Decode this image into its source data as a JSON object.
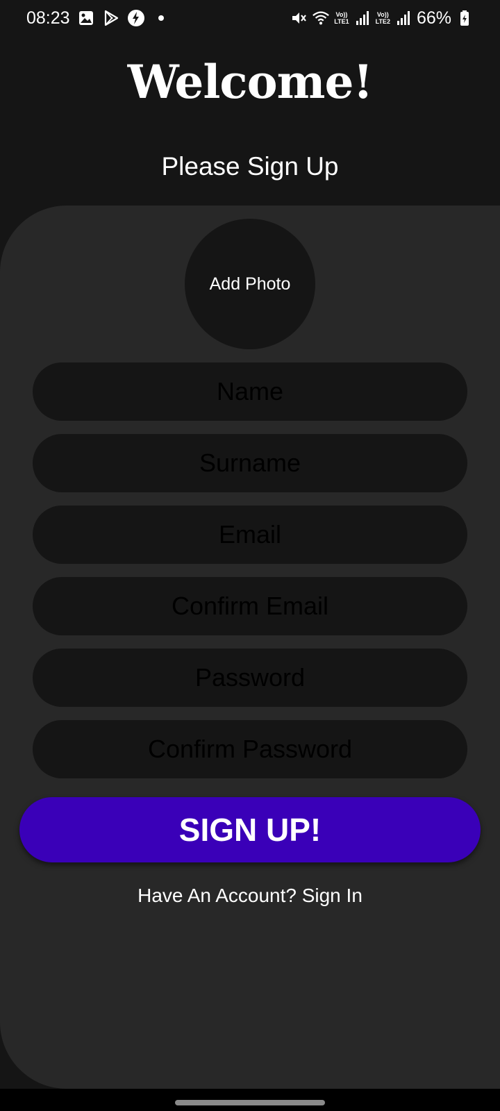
{
  "status_bar": {
    "time": "08:23",
    "battery": "66%",
    "sim1_label": "Vo))",
    "sim1_net": "LTE1",
    "sim2_label": "Vo))",
    "sim2_net": "LTE2",
    "icons": [
      "gallery-icon",
      "play-store-icon",
      "bolt-icon",
      "dot-icon",
      "mute-icon",
      "wifi-icon",
      "signal-icon",
      "battery-icon"
    ]
  },
  "header": {
    "title": "Welcome!",
    "subtitle": "Please Sign Up"
  },
  "form": {
    "photo_label": "Add Photo",
    "fields": {
      "name": {
        "placeholder": "Name",
        "value": ""
      },
      "surname": {
        "placeholder": "Surname",
        "value": ""
      },
      "email": {
        "placeholder": "Email",
        "value": ""
      },
      "confirm_email": {
        "placeholder": "Confirm Email",
        "value": ""
      },
      "password": {
        "placeholder": "Password",
        "value": ""
      },
      "confirm_password": {
        "placeholder": "Confirm Password",
        "value": ""
      }
    },
    "submit_label": "SIGN UP!",
    "signin_text": "Have An Account? Sign In"
  },
  "colors": {
    "background": "#151515",
    "card": "#282828",
    "field": "#151515",
    "button": "#3a00b8",
    "text": "#ffffff"
  }
}
